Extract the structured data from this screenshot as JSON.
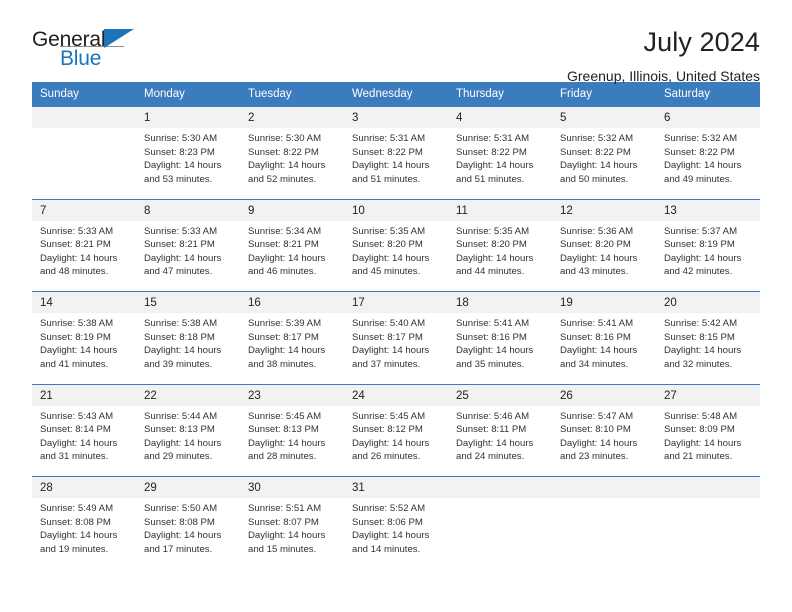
{
  "brand": {
    "name_part1": "General",
    "name_part2": "Blue",
    "flag_icon": "brand-flag-icon"
  },
  "header": {
    "month_title": "July 2024",
    "location": "Greenup, Illinois, United States"
  },
  "colors": {
    "header_blue": "#3a7cbe",
    "brand_blue": "#1b75bb",
    "day_number_band": "#f2f2f2",
    "text": "#333333"
  },
  "calendar": {
    "weekday_headers": [
      "Sunday",
      "Monday",
      "Tuesday",
      "Wednesday",
      "Thursday",
      "Friday",
      "Saturday"
    ],
    "weeks": [
      {
        "days": [
          {
            "number": "",
            "sunrise": "",
            "sunset": "",
            "daylight_line1": "",
            "daylight_line2": "",
            "empty": true
          },
          {
            "number": "1",
            "sunrise": "Sunrise: 5:30 AM",
            "sunset": "Sunset: 8:23 PM",
            "daylight_line1": "Daylight: 14 hours",
            "daylight_line2": "and 53 minutes."
          },
          {
            "number": "2",
            "sunrise": "Sunrise: 5:30 AM",
            "sunset": "Sunset: 8:22 PM",
            "daylight_line1": "Daylight: 14 hours",
            "daylight_line2": "and 52 minutes."
          },
          {
            "number": "3",
            "sunrise": "Sunrise: 5:31 AM",
            "sunset": "Sunset: 8:22 PM",
            "daylight_line1": "Daylight: 14 hours",
            "daylight_line2": "and 51 minutes."
          },
          {
            "number": "4",
            "sunrise": "Sunrise: 5:31 AM",
            "sunset": "Sunset: 8:22 PM",
            "daylight_line1": "Daylight: 14 hours",
            "daylight_line2": "and 51 minutes."
          },
          {
            "number": "5",
            "sunrise": "Sunrise: 5:32 AM",
            "sunset": "Sunset: 8:22 PM",
            "daylight_line1": "Daylight: 14 hours",
            "daylight_line2": "and 50 minutes."
          },
          {
            "number": "6",
            "sunrise": "Sunrise: 5:32 AM",
            "sunset": "Sunset: 8:22 PM",
            "daylight_line1": "Daylight: 14 hours",
            "daylight_line2": "and 49 minutes."
          }
        ]
      },
      {
        "days": [
          {
            "number": "7",
            "sunrise": "Sunrise: 5:33 AM",
            "sunset": "Sunset: 8:21 PM",
            "daylight_line1": "Daylight: 14 hours",
            "daylight_line2": "and 48 minutes."
          },
          {
            "number": "8",
            "sunrise": "Sunrise: 5:33 AM",
            "sunset": "Sunset: 8:21 PM",
            "daylight_line1": "Daylight: 14 hours",
            "daylight_line2": "and 47 minutes."
          },
          {
            "number": "9",
            "sunrise": "Sunrise: 5:34 AM",
            "sunset": "Sunset: 8:21 PM",
            "daylight_line1": "Daylight: 14 hours",
            "daylight_line2": "and 46 minutes."
          },
          {
            "number": "10",
            "sunrise": "Sunrise: 5:35 AM",
            "sunset": "Sunset: 8:20 PM",
            "daylight_line1": "Daylight: 14 hours",
            "daylight_line2": "and 45 minutes."
          },
          {
            "number": "11",
            "sunrise": "Sunrise: 5:35 AM",
            "sunset": "Sunset: 8:20 PM",
            "daylight_line1": "Daylight: 14 hours",
            "daylight_line2": "and 44 minutes."
          },
          {
            "number": "12",
            "sunrise": "Sunrise: 5:36 AM",
            "sunset": "Sunset: 8:20 PM",
            "daylight_line1": "Daylight: 14 hours",
            "daylight_line2": "and 43 minutes."
          },
          {
            "number": "13",
            "sunrise": "Sunrise: 5:37 AM",
            "sunset": "Sunset: 8:19 PM",
            "daylight_line1": "Daylight: 14 hours",
            "daylight_line2": "and 42 minutes."
          }
        ]
      },
      {
        "days": [
          {
            "number": "14",
            "sunrise": "Sunrise: 5:38 AM",
            "sunset": "Sunset: 8:19 PM",
            "daylight_line1": "Daylight: 14 hours",
            "daylight_line2": "and 41 minutes."
          },
          {
            "number": "15",
            "sunrise": "Sunrise: 5:38 AM",
            "sunset": "Sunset: 8:18 PM",
            "daylight_line1": "Daylight: 14 hours",
            "daylight_line2": "and 39 minutes."
          },
          {
            "number": "16",
            "sunrise": "Sunrise: 5:39 AM",
            "sunset": "Sunset: 8:17 PM",
            "daylight_line1": "Daylight: 14 hours",
            "daylight_line2": "and 38 minutes."
          },
          {
            "number": "17",
            "sunrise": "Sunrise: 5:40 AM",
            "sunset": "Sunset: 8:17 PM",
            "daylight_line1": "Daylight: 14 hours",
            "daylight_line2": "and 37 minutes."
          },
          {
            "number": "18",
            "sunrise": "Sunrise: 5:41 AM",
            "sunset": "Sunset: 8:16 PM",
            "daylight_line1": "Daylight: 14 hours",
            "daylight_line2": "and 35 minutes."
          },
          {
            "number": "19",
            "sunrise": "Sunrise: 5:41 AM",
            "sunset": "Sunset: 8:16 PM",
            "daylight_line1": "Daylight: 14 hours",
            "daylight_line2": "and 34 minutes."
          },
          {
            "number": "20",
            "sunrise": "Sunrise: 5:42 AM",
            "sunset": "Sunset: 8:15 PM",
            "daylight_line1": "Daylight: 14 hours",
            "daylight_line2": "and 32 minutes."
          }
        ]
      },
      {
        "days": [
          {
            "number": "21",
            "sunrise": "Sunrise: 5:43 AM",
            "sunset": "Sunset: 8:14 PM",
            "daylight_line1": "Daylight: 14 hours",
            "daylight_line2": "and 31 minutes."
          },
          {
            "number": "22",
            "sunrise": "Sunrise: 5:44 AM",
            "sunset": "Sunset: 8:13 PM",
            "daylight_line1": "Daylight: 14 hours",
            "daylight_line2": "and 29 minutes."
          },
          {
            "number": "23",
            "sunrise": "Sunrise: 5:45 AM",
            "sunset": "Sunset: 8:13 PM",
            "daylight_line1": "Daylight: 14 hours",
            "daylight_line2": "and 28 minutes."
          },
          {
            "number": "24",
            "sunrise": "Sunrise: 5:45 AM",
            "sunset": "Sunset: 8:12 PM",
            "daylight_line1": "Daylight: 14 hours",
            "daylight_line2": "and 26 minutes."
          },
          {
            "number": "25",
            "sunrise": "Sunrise: 5:46 AM",
            "sunset": "Sunset: 8:11 PM",
            "daylight_line1": "Daylight: 14 hours",
            "daylight_line2": "and 24 minutes."
          },
          {
            "number": "26",
            "sunrise": "Sunrise: 5:47 AM",
            "sunset": "Sunset: 8:10 PM",
            "daylight_line1": "Daylight: 14 hours",
            "daylight_line2": "and 23 minutes."
          },
          {
            "number": "27",
            "sunrise": "Sunrise: 5:48 AM",
            "sunset": "Sunset: 8:09 PM",
            "daylight_line1": "Daylight: 14 hours",
            "daylight_line2": "and 21 minutes."
          }
        ]
      },
      {
        "days": [
          {
            "number": "28",
            "sunrise": "Sunrise: 5:49 AM",
            "sunset": "Sunset: 8:08 PM",
            "daylight_line1": "Daylight: 14 hours",
            "daylight_line2": "and 19 minutes."
          },
          {
            "number": "29",
            "sunrise": "Sunrise: 5:50 AM",
            "sunset": "Sunset: 8:08 PM",
            "daylight_line1": "Daylight: 14 hours",
            "daylight_line2": "and 17 minutes."
          },
          {
            "number": "30",
            "sunrise": "Sunrise: 5:51 AM",
            "sunset": "Sunset: 8:07 PM",
            "daylight_line1": "Daylight: 14 hours",
            "daylight_line2": "and 15 minutes."
          },
          {
            "number": "31",
            "sunrise": "Sunrise: 5:52 AM",
            "sunset": "Sunset: 8:06 PM",
            "daylight_line1": "Daylight: 14 hours",
            "daylight_line2": "and 14 minutes."
          },
          {
            "number": "",
            "sunrise": "",
            "sunset": "",
            "daylight_line1": "",
            "daylight_line2": "",
            "empty": true
          },
          {
            "number": "",
            "sunrise": "",
            "sunset": "",
            "daylight_line1": "",
            "daylight_line2": "",
            "empty": true
          },
          {
            "number": "",
            "sunrise": "",
            "sunset": "",
            "daylight_line1": "",
            "daylight_line2": "",
            "empty": true
          }
        ]
      }
    ]
  }
}
